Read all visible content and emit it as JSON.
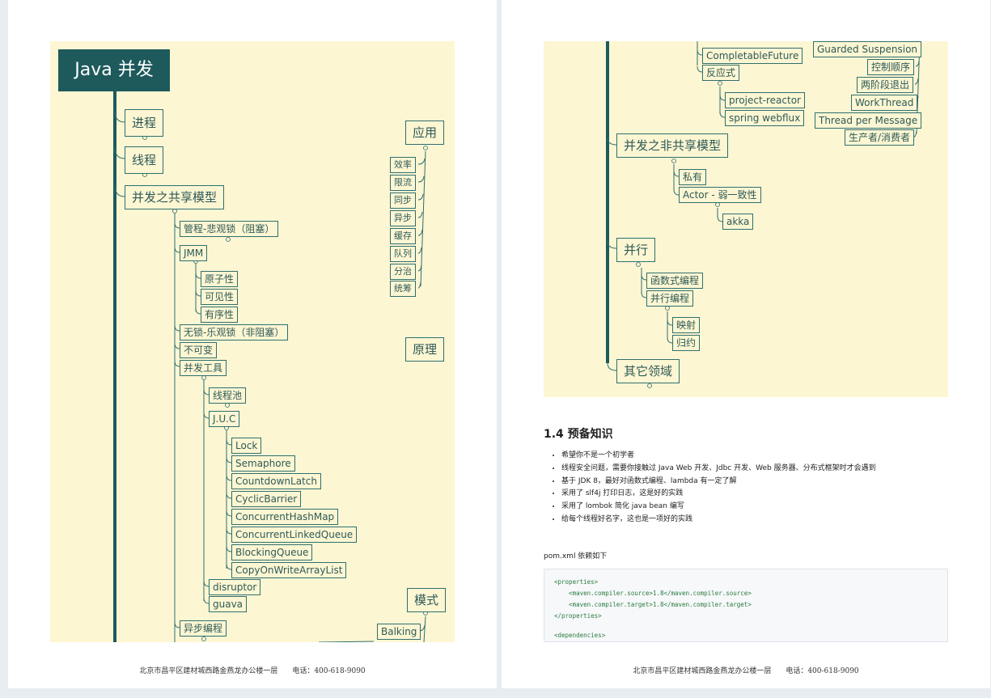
{
  "left_page": {
    "root": "Java 并发",
    "main_branches": [
      "进程",
      "线程",
      "并发之共享模型"
    ],
    "shared_model_children": [
      "管程-悲观锁（阻塞）",
      "JMM",
      "无锁-乐观锁（非阻塞）",
      "不可变",
      "并发工具",
      "异步编程"
    ],
    "jmm_children": [
      "原子性",
      "可见性",
      "有序性"
    ],
    "tools_children": [
      "线程池",
      "J.U.C",
      "disruptor",
      "guava"
    ],
    "juc_children": [
      "Lock",
      "Semaphore",
      "CountdownLatch",
      "CyclicBarrier",
      "ConcurrentHashMap",
      "ConcurrentLinkedQueue",
      "BlockingQueue",
      "CopyOnWriteArrayList"
    ],
    "app_title": "应用",
    "app_children": [
      "效率",
      "限流",
      "同步",
      "异步",
      "缓存",
      "队列",
      "分治",
      "统筹"
    ],
    "principle_title": "原理",
    "pattern_title": "模式",
    "pattern_children": [
      "Balking"
    ],
    "footer": "北京市昌平区建材城西路金燕龙办公楼一层　　电话：400-618-9090"
  },
  "right_page": {
    "top_children": [
      "CompletableFuture",
      "反应式"
    ],
    "reactive_children": [
      "project-reactor",
      "spring webflux"
    ],
    "pattern_children": [
      "Guarded Suspension",
      "控制顺序",
      "两阶段退出",
      "WorkThread",
      "Thread per Message",
      "生产者/消费者"
    ],
    "nonshared_title": "并发之非共享模型",
    "nonshared_children": [
      "私有",
      "Actor - 弱一致性"
    ],
    "actor_children": [
      "akka"
    ],
    "parallel_title": "并行",
    "parallel_children": [
      "函数式编程",
      "并行编程"
    ],
    "parallel_prog_children": [
      "映射",
      "归约"
    ],
    "other_title": "其它领域",
    "section_title": "1.4 预备知识",
    "bullets": [
      "希望你不是一个初学者",
      "线程安全问题，需要你接触过 Java Web 开发、Jdbc 开发、Web 服务器、分布式框架时才会遇到",
      "基于 JDK 8，最好对函数式编程、lambda 有一定了解",
      "采用了 slf4j 打印日志，这是好的实践",
      "采用了 lombok 简化 java bean 编写",
      "给每个线程好名字，这也是一项好的实践"
    ],
    "pom_intro": "pom.xml 依赖如下",
    "code_lines": [
      "<properties>",
      "    <maven.compiler.source>1.8</maven.compiler.source>",
      "    <maven.compiler.target>1.8</maven.compiler.target>",
      "</properties>",
      "",
      "<dependencies>"
    ],
    "footer": "北京市昌平区建材城西路金燕龙办公楼一层　　电话：400-618-9090"
  }
}
